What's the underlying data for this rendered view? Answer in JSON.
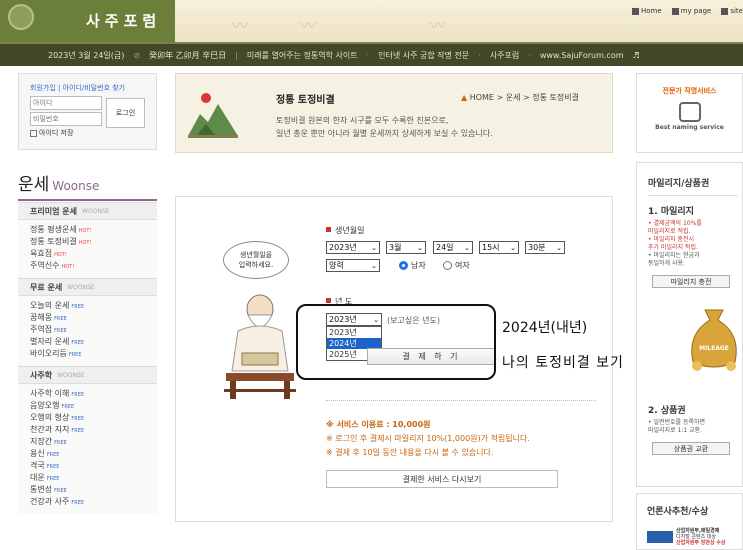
{
  "header": {
    "logo_text": "사주포럼",
    "top_links": [
      "Home",
      "my page",
      "site"
    ],
    "bar_items": [
      "2023년 3월 24일(금)",
      "癸卯年 乙卯月 辛巳日",
      "미래를 열어주는 정통역학 사이트",
      "인터넷 사주 궁합 작명 전문",
      "사주포럼",
      "www.SajuForum.com",
      "♬"
    ]
  },
  "login": {
    "links": "회원가입 | 아이디/비밀번호 찾기",
    "id_placeholder": "아이디",
    "pw_placeholder": "비밀번호",
    "login_button": "로그인",
    "save_id": "아이디 저장"
  },
  "sidebar": {
    "title": "운세",
    "title_en": "Woonse",
    "sections": [
      {
        "name": "프리미엄 운세",
        "tag": "WOONSE",
        "items": [
          {
            "label": "정통 평생운세",
            "badge": "HOT!"
          },
          {
            "label": "정통 토정비결",
            "badge": "HOT!"
          },
          {
            "label": "육효점",
            "badge": "HOT!"
          },
          {
            "label": "주역신수",
            "badge": "HOT!"
          }
        ]
      },
      {
        "name": "무료 운세",
        "tag": "WOONSE",
        "items": [
          {
            "label": "오늘의 운세",
            "badge": "FREE"
          },
          {
            "label": "꿈해몽",
            "badge": "FREE"
          },
          {
            "label": "주역점",
            "badge": "FREE"
          },
          {
            "label": "별자리 운세",
            "badge": "FREE"
          },
          {
            "label": "바이오리듬",
            "badge": "FREE"
          }
        ]
      },
      {
        "name": "사주학",
        "tag": "WOONSE",
        "items": [
          {
            "label": "사주학 이해",
            "badge": "FREE"
          },
          {
            "label": "음양오행",
            "badge": "FREE"
          },
          {
            "label": "오행의 형상",
            "badge": "FREE"
          },
          {
            "label": "천간과 지지",
            "badge": "FREE"
          },
          {
            "label": "지장간",
            "badge": "FREE"
          },
          {
            "label": "용신",
            "badge": "FREE"
          },
          {
            "label": "격국",
            "badge": "FREE"
          },
          {
            "label": "대운",
            "badge": "FREE"
          },
          {
            "label": "통변성",
            "badge": "FREE"
          },
          {
            "label": "건강과 사주",
            "badge": "FREE"
          }
        ]
      }
    ]
  },
  "banner": {
    "title": "정통 토정비결",
    "breadcrumb_home": "HOME",
    "breadcrumb_rest": "> 운세 > 정통 토정비결",
    "desc_line1": "토정비결 원본의 한자 시구를 모두 수록한 진본으로,",
    "desc_line2": "일년 총운 뿐만 아니라 월별 운세까지 상세하게 보실 수 있습니다."
  },
  "form": {
    "bubble_line1": "생년월일을",
    "bubble_line2": "입력하세요.",
    "birth_label": "생년월일",
    "year": "2023년",
    "month": "3월",
    "day": "24일",
    "hour": "15시",
    "minute": "30분",
    "calendar": "양력",
    "gender_male": "남자",
    "gender_female": "여자",
    "target_label": "년 도",
    "target_year": "2023년",
    "target_hint": "(보고싶은 년도)",
    "dropdown_options": [
      "2023년",
      "2024년",
      "2025년"
    ],
    "pay_button": "결 제 하 기",
    "notice1": "※ 서비스 이용료 : 10,000원",
    "notice2": "※ 로그인 후 결제시 마일리지 10%(1,000원)가 적립됩니다.",
    "notice3": "※ 결제 후 10일 동안 내용을 다시 볼 수 있습니다.",
    "again_button": "결제한 서비스 다시보기"
  },
  "annotation": {
    "line1": "2024년(내년)",
    "line2": "나의 토정비결 보기"
  },
  "right": {
    "naming_title": "전문가 작명서비스",
    "naming_sub": "Best naming service",
    "mileage_title": "마일리지/상품권",
    "mileage_sub": "1. 마일리지",
    "mileage_lines": [
      "• 결제금액의 10%를",
      "  마일리지로 적립.",
      "• 마일리지 충전시",
      "  추가 마일리지 적립.",
      "• 마일리지는 현금과",
      "  동일하게 사용."
    ],
    "mileage_button": "마일리지 충전",
    "bag_text": "MILEAGE",
    "gift_sub": "2. 상품권",
    "gift_lines": [
      "• 일련번호를 등록하면",
      "  마일리지로 1:1 교환."
    ],
    "gift_button": "상품권 교환",
    "rec_title": "언론사추천/수상",
    "rec_line1": "산업자원부,매일경제",
    "rec_line2": "디지털 콘텐츠 대상",
    "rec_line3": "산업자원부 장관상 수상"
  }
}
